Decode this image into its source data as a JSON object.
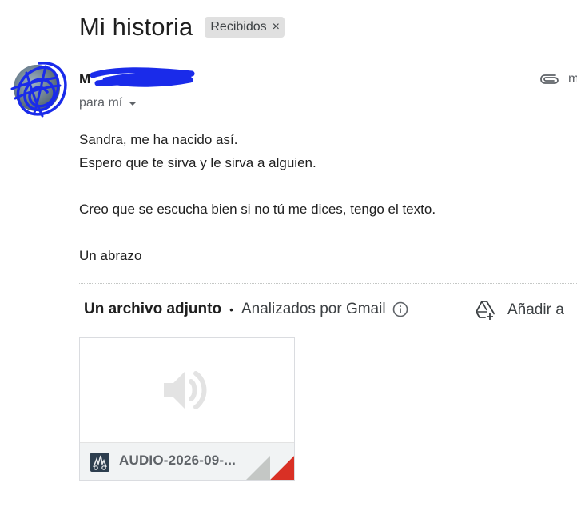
{
  "subject": {
    "title": "Mi historia",
    "label": "Recibidos",
    "label_remove": "×"
  },
  "sender": {
    "initial": "M",
    "recipient": "para mí",
    "time_fragment": "m"
  },
  "body": {
    "lines": [
      "Sandra, me ha nacido así.",
      "Espero que te sirva y le sirva a alguien.",
      "Creo que se escucha bien si no tú me dices, tengo el texto.",
      "Un abrazo"
    ]
  },
  "attachments": {
    "count_label": "Un archivo adjunto",
    "separator": "•",
    "scanned_label": "Analizados por Gmail",
    "add_to_drive_label": "Añadir a",
    "file_name": "AUDIO-2026-09-...",
    "file_icon": "audio-file-icon",
    "preview_icon": "speaker-icon"
  },
  "colors": {
    "scribble": "#1a2bea",
    "label_chip_bg": "#e0e0e0",
    "corner_fold": "#d93025"
  }
}
